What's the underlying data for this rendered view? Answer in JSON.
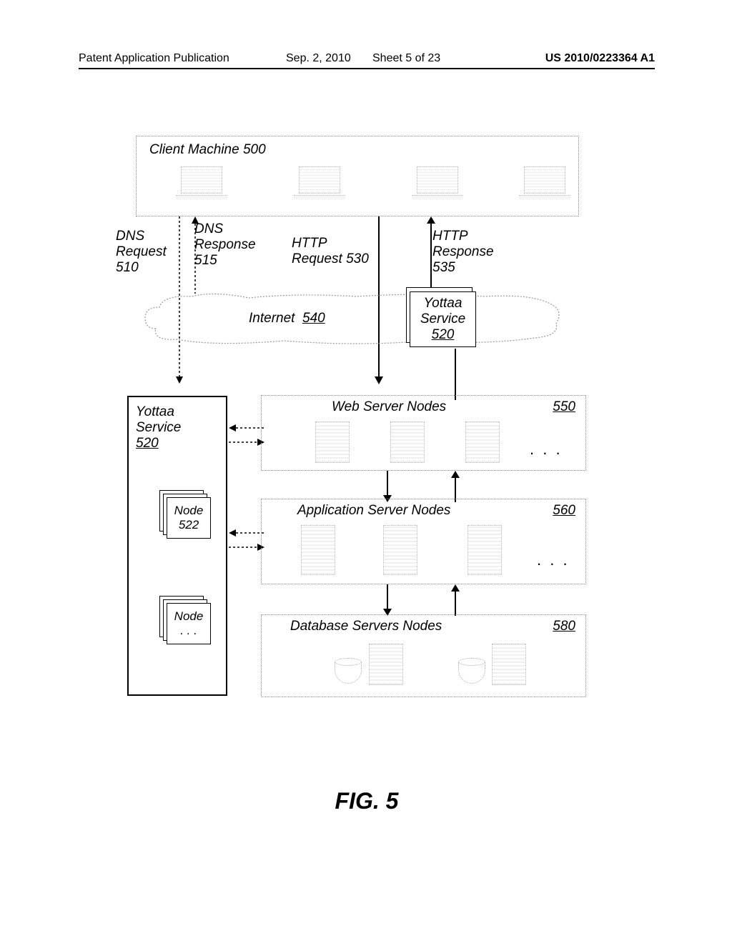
{
  "header": {
    "publication": "Patent Application Publication",
    "date": "Sep. 2, 2010",
    "sheet": "Sheet 5 of 23",
    "appNumber": "US 2010/0223364 A1"
  },
  "figure": {
    "caption": "FIG. 5",
    "clientMachine": {
      "label": "Client Machine",
      "num": "500"
    },
    "dnsRequest": {
      "label": "DNS Request",
      "num": "510"
    },
    "dnsResponse": {
      "label": "DNS Response",
      "num": "515"
    },
    "httpRequest": {
      "label": "HTTP Request",
      "num": "530"
    },
    "httpResponse": {
      "label": "HTTP Response",
      "num": "535"
    },
    "internet": {
      "label": "Internet",
      "num": "540"
    },
    "yottaaService": {
      "label": "Yottaa Service",
      "num": "520"
    },
    "yottaaServiceSide": {
      "label": "Yottaa Service",
      "num": "520"
    },
    "node": {
      "label": "Node",
      "num": "522"
    },
    "nodeMore": {
      "label": "Node",
      "dots": ". . ."
    },
    "webServers": {
      "label": "Web Server Nodes",
      "num": "550"
    },
    "appServers": {
      "label": "Application Server Nodes",
      "num": "560"
    },
    "dbServers": {
      "label": "Database Servers  Nodes",
      "num": "580"
    },
    "ellipsis": ". . ."
  }
}
